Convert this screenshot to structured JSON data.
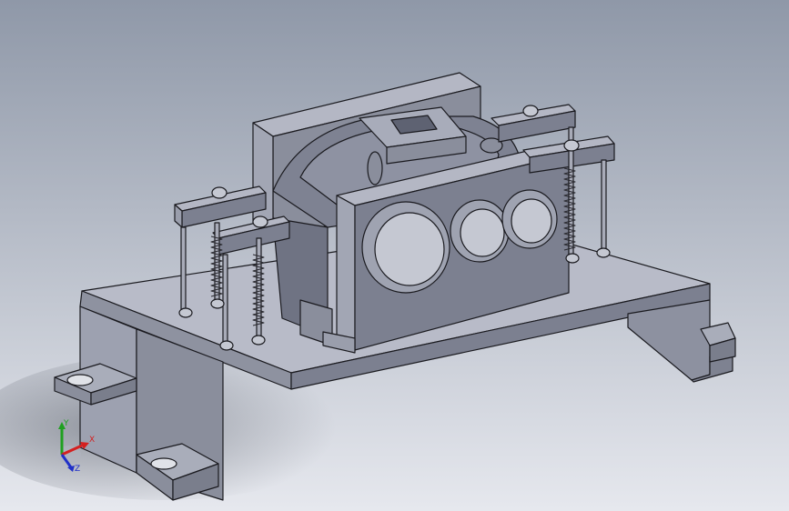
{
  "viewport": {
    "background_top": "#8f98a8",
    "background_bottom": "#e6e8ee",
    "model_color": "#9ea1b0",
    "edge_color": "#1a1a1f"
  },
  "triad": {
    "x_label": "X",
    "y_label": "Y",
    "z_label": "Z",
    "x_color": "#d42020",
    "y_color": "#20a020",
    "z_color": "#2030c8"
  }
}
